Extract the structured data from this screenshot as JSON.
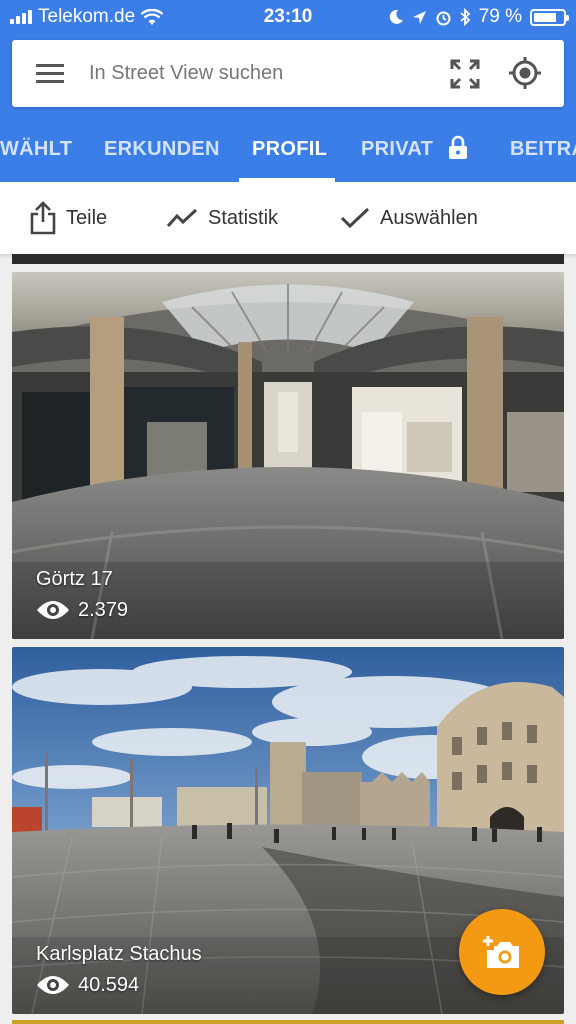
{
  "status_bar": {
    "carrier": "Telekom.de",
    "time": "23:10",
    "battery": "79 %"
  },
  "search": {
    "placeholder": "In Street View suchen"
  },
  "tabs": [
    {
      "label": "WÄHLT"
    },
    {
      "label": "ERKUNDEN"
    },
    {
      "label": "PROFIL"
    },
    {
      "label": "PRIVAT"
    },
    {
      "label": "BEITRA"
    }
  ],
  "actions": {
    "share": "Teile",
    "stats": "Statistik",
    "select": "Auswählen"
  },
  "photos": [
    {
      "title": "Görtz 17",
      "views": "2.379"
    },
    {
      "title": "Karlsplatz Stachus",
      "views": "40.594"
    }
  ],
  "colors": {
    "header_blue": "#3b7ee8",
    "fab_orange": "#f49a12"
  },
  "icons": {
    "menu": "menu-icon",
    "expand": "fullscreen-icon",
    "locate": "my-location-icon",
    "lock": "lock-icon",
    "share": "share-icon",
    "stats": "trend-icon",
    "select": "check-icon",
    "views": "eye-icon",
    "fab": "add-photo-icon"
  }
}
